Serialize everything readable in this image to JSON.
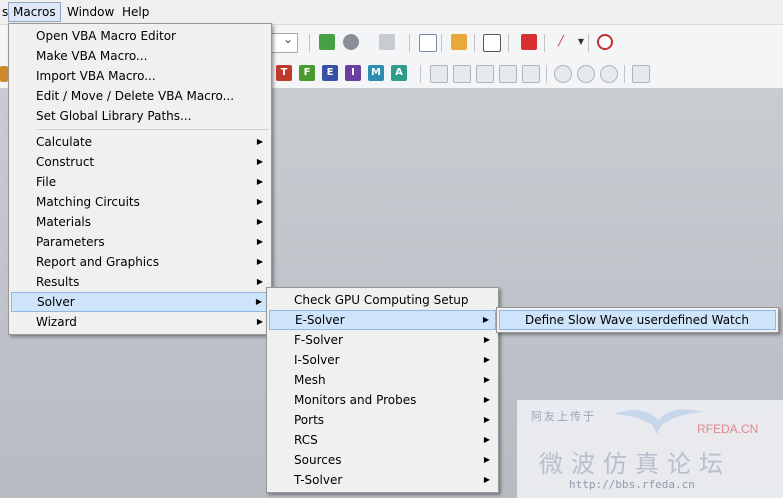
{
  "menubar": {
    "cut_item": "s",
    "macros": "Macros",
    "window": "Window",
    "help": "Help"
  },
  "macros_menu": {
    "top_items": [
      "Open VBA Macro Editor",
      "Make VBA Macro...",
      "Import VBA Macro...",
      "Edit / Move / Delete VBA Macro...",
      "Set Global Library Paths..."
    ],
    "sub_items": [
      "Calculate",
      "Construct",
      "File",
      "Matching Circuits",
      "Materials",
      "Parameters",
      "Report and Graphics",
      "Results",
      "Solver",
      "Wizard"
    ]
  },
  "solver_menu": {
    "items": [
      "Check GPU Computing Setup",
      "E-Solver",
      "F-Solver",
      "I-Solver",
      "Mesh",
      "Monitors and Probes",
      "Ports",
      "RCS",
      "Sources",
      "T-Solver"
    ]
  },
  "esolver_menu": {
    "items": [
      "Define Slow Wave userdefined Watch"
    ]
  },
  "watermark": {
    "top_text": "阿友上传于",
    "brand": "RFEDA.CN",
    "big_text": "微波仿真论坛",
    "url": "http://bbs.rfeda.cn"
  },
  "toolbar_letters": [
    "T",
    "F",
    "E",
    "I",
    "M",
    "A"
  ],
  "colors": {
    "highlight": "#cde4fa",
    "menu_bg": "#f0f0f0",
    "t_icon": "#c0392b",
    "f_icon": "#4a9a2e",
    "e_icon": "#3a4fa8",
    "i_icon": "#6a3fa0",
    "m_icon": "#2d8db0",
    "a_icon": "#2e9e8a"
  }
}
